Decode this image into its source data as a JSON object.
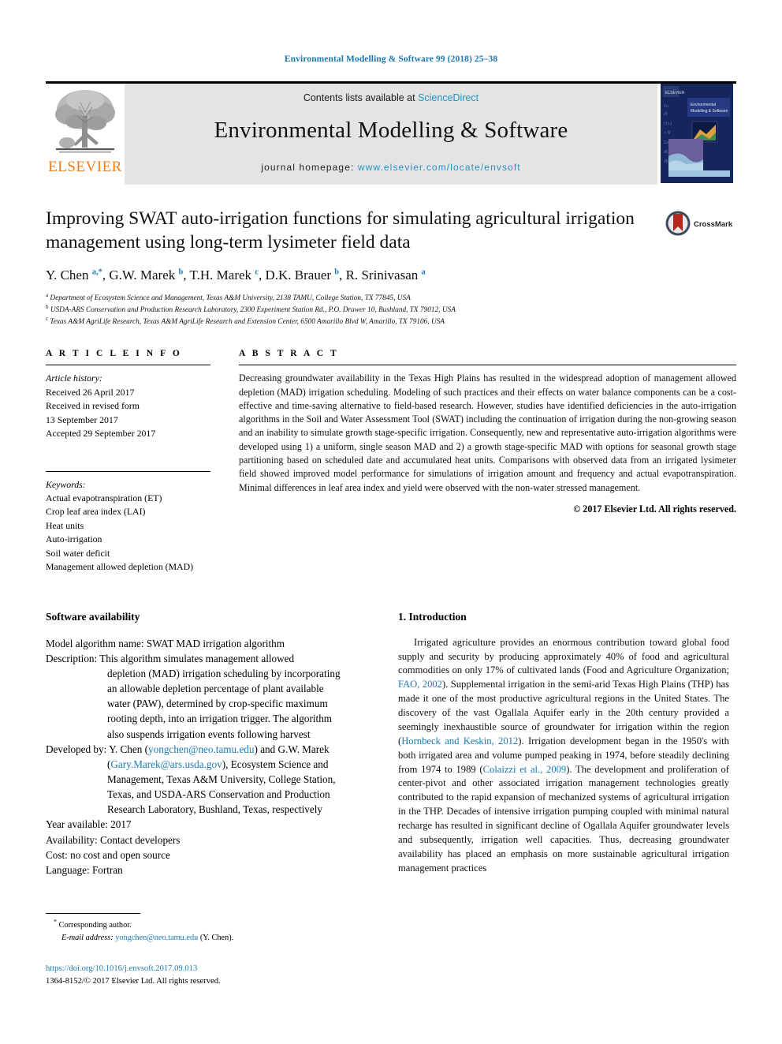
{
  "running_head": "Environmental Modelling & Software 99 (2018) 25–38",
  "masthead": {
    "contents_prefix": "Contents lists available at ",
    "sciencedirect": "ScienceDirect",
    "journal_name": "Environmental Modelling & Software",
    "homepage_prefix": "journal homepage: ",
    "homepage_url": "www.elsevier.com/locate/envsoft",
    "publisher": "ELSEVIER",
    "cover_title": "Environmental Modelling & Software",
    "link_color": "#2196c4",
    "band_color": "#e4e4e4",
    "elsevier_orange": "#ef7d1a"
  },
  "article": {
    "title": "Improving SWAT auto-irrigation functions for simulating agricultural irrigation management using long-term lysimeter field data",
    "authors_html": "Y. Chen <sup>a,*</sup>, G.W. Marek <sup>b</sup>, T.H. Marek <sup>c</sup>, D.K. Brauer <sup>b</sup>, R. Srinivasan <sup>a</sup>",
    "affiliations": [
      {
        "marker": "a",
        "text": "Department of Ecosystem Science and Management, Texas A&M University, 2138 TAMU, College Station, TX 77845, USA"
      },
      {
        "marker": "b",
        "text": "USDA-ARS Conservation and Production Research Laboratory, 2300 Experiment Station Rd., P.O. Drawer 10, Bushland, TX 79012, USA"
      },
      {
        "marker": "c",
        "text": "Texas A&M AgriLife Research, Texas A&M AgriLife Research and Extension Center, 6500 Amarillo Blvd W, Amarillo, TX 79106, USA"
      }
    ],
    "crossmark_label": "CrossMark"
  },
  "article_info": {
    "heading": "A R T I C L E  I N F O",
    "history_title": "Article history:",
    "history": [
      "Received 26 April 2017",
      "Received in revised form",
      "13 September 2017",
      "Accepted 29 September 2017"
    ],
    "keywords_title": "Keywords:",
    "keywords": [
      "Actual evapotranspiration (ET)",
      "Crop leaf area index (LAI)",
      "Heat units",
      "Auto-irrigation",
      "Soil water deficit",
      "Management allowed depletion (MAD)"
    ]
  },
  "abstract": {
    "heading": "A B S T R A C T",
    "text": "Decreasing groundwater availability in the Texas High Plains has resulted in the widespread adoption of management allowed depletion (MAD) irrigation scheduling. Modeling of such practices and their effects on water balance components can be a cost-effective and time-saving alternative to field-based research. However, studies have identified deficiencies in the auto-irrigation algorithms in the Soil and Water Assessment Tool (SWAT) including the continuation of irrigation during the non-growing season and an inability to simulate growth stage-specific irrigation. Consequently, new and representative auto-irrigation algorithms were developed using 1) a uniform, single season MAD and 2) a growth stage-specific MAD with options for seasonal growth stage partitioning based on scheduled date and accumulated heat units. Comparisons with observed data from an irrigated lysimeter field showed improved model performance for simulations of irrigation amount and frequency and actual evapotranspiration. Minimal differences in leaf area index and yield were observed with the non-water stressed management.",
    "copyright": "© 2017 Elsevier Ltd. All rights reserved."
  },
  "software_availability": {
    "heading": "Software availability",
    "model_name_line": "Model algorithm name: SWAT MAD irrigation algorithm",
    "description_first": "Description: This algorithm simulates management allowed",
    "description_rest": [
      "depletion (MAD) irrigation scheduling by incorporating",
      "an allowable depletion percentage of plant available",
      "water (PAW), determined by crop-specific maximum",
      "rooting depth, into an irrigation trigger. The algorithm",
      "also suspends irrigation events following harvest"
    ],
    "developed_by_prefix": "Developed by: Y. Chen (",
    "developed_by_email1": "yongchen@neo.tamu.edu",
    "developed_by_mid": ") and G.W. Marek",
    "developed_by_email2": "Gary.Marek@ars.usda.gov",
    "developed_by_rest": [
      "), Ecosystem Science and",
      "Management, Texas A&M University, College Station,",
      "Texas, and USDA-ARS Conservation and Production",
      "Research Laboratory, Bushland, Texas, respectively"
    ],
    "year_line": "Year available: 2017",
    "availability_line": "Availability: Contact developers",
    "cost_line": "Cost: no cost and open source",
    "language_line": "Language: Fortran"
  },
  "introduction": {
    "heading": "1. Introduction",
    "paragraph_parts": [
      {
        "type": "text",
        "value": "Irrigated agriculture provides an enormous contribution toward global food supply and security by producing approximately 40% of food and agricultural commodities on only 17% of cultivated lands (Food and Agriculture Organization; "
      },
      {
        "type": "link",
        "value": "FAO, 2002"
      },
      {
        "type": "text",
        "value": "). Supplemental irrigation in the semi-arid Texas High Plains (THP) has made it one of the most productive agricultural regions in the United States. The discovery of the vast Ogallala Aquifer early in the 20th century provided a seemingly inexhaustible source of groundwater for irrigation within the region ("
      },
      {
        "type": "link",
        "value": "Hornbeck and Keskin, 2012"
      },
      {
        "type": "text",
        "value": "). Irrigation development began in the 1950's with both irrigated area and volume pumped peaking in 1974, before steadily declining from 1974 to 1989 ("
      },
      {
        "type": "link",
        "value": "Colaizzi et al., 2009"
      },
      {
        "type": "text",
        "value": "). The development and proliferation of center-pivot and other associated irrigation management technologies greatly contributed to the rapid expansion of mechanized systems of agricultural irrigation in the THP. Decades of intensive irrigation pumping coupled with minimal natural recharge has resulted in significant decline of Ogallala Aquifer groundwater levels and subsequently, irrigation well capacities. Thus, decreasing groundwater availability has placed an emphasis on more sustainable agricultural irrigation management practices"
      }
    ]
  },
  "footnotes": {
    "corresponding_author": "Corresponding author.",
    "email_label": "E-mail address:",
    "email": "yongchen@neo.tamu.edu",
    "email_suffix": "(Y. Chen).",
    "doi": "https://doi.org/10.1016/j.envsoft.2017.09.013",
    "issn": "1364-8152/© 2017 Elsevier Ltd. All rights reserved."
  }
}
